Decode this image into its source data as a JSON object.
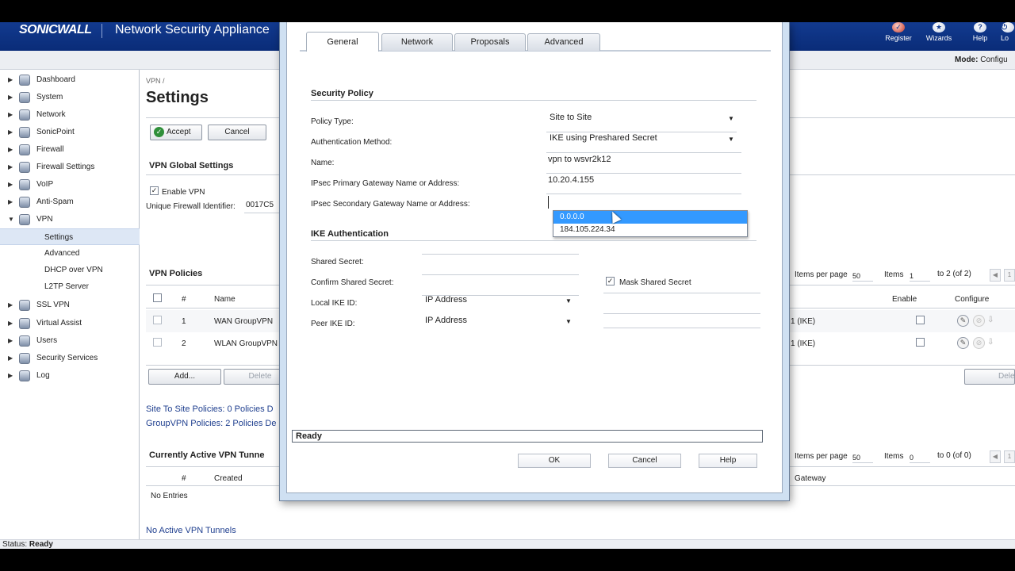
{
  "header": {
    "logo": "SONICWALL",
    "title": "Network Security Appliance",
    "tools": [
      {
        "label": "Register",
        "icon": "register-icon"
      },
      {
        "label": "Wizards",
        "icon": "wizard-icon"
      },
      {
        "label": "Help",
        "icon": "help-icon"
      },
      {
        "label": "Lo",
        "icon": "logout-icon"
      }
    ],
    "mode_label": "Mode:",
    "mode_value": "Configu"
  },
  "sidebar": {
    "items": [
      {
        "label": "Dashboard",
        "icon": "dashboard-icon"
      },
      {
        "label": "System",
        "icon": "system-icon"
      },
      {
        "label": "Network",
        "icon": "network-icon"
      },
      {
        "label": "SonicPoint",
        "icon": "sonicpoint-icon"
      },
      {
        "label": "Firewall",
        "icon": "firewall-icon"
      },
      {
        "label": "Firewall Settings",
        "icon": "firewall-settings-icon"
      },
      {
        "label": "VoIP",
        "icon": "voip-icon"
      },
      {
        "label": "Anti-Spam",
        "icon": "anti-spam-icon"
      },
      {
        "label": "VPN",
        "icon": "vpn-icon"
      },
      {
        "label": "SSL VPN",
        "icon": "ssl-vpn-icon"
      },
      {
        "label": "Virtual Assist",
        "icon": "virtual-assist-icon"
      },
      {
        "label": "Users",
        "icon": "users-icon"
      },
      {
        "label": "Security Services",
        "icon": "security-services-icon"
      },
      {
        "label": "Log",
        "icon": "log-icon"
      }
    ],
    "vpn_sub": [
      "Settings",
      "Advanced",
      "DHCP over VPN",
      "L2TP Server"
    ]
  },
  "main": {
    "breadcrumb": "VPN /",
    "title": "Settings",
    "accept": "Accept",
    "cancel": "Cancel",
    "global_title": "VPN Global Settings",
    "enable_vpn": "Enable VPN",
    "ufi_label": "Unique Firewall Identifier:",
    "ufi_value": "0017C5",
    "policies_title": "VPN Policies",
    "items_per_page_label": "Items per page",
    "items_per_page": "50",
    "items_label": "Items",
    "items_from": "1",
    "items_range": "to 2 (of 2)",
    "col_num": "#",
    "col_name": "Name",
    "col_enable": "Enable",
    "col_configure": "Configure",
    "rows": [
      {
        "num": "1",
        "name": "WAN GroupVPN",
        "gateway": "1 (IKE)"
      },
      {
        "num": "2",
        "name": "WLAN GroupVPN",
        "gateway": "1 (IKE)"
      }
    ],
    "add": "Add...",
    "delete": "Delete",
    "delete_all": "Delete A",
    "site_policies": "Site To Site Policies: 0 Policies D",
    "group_policies": "GroupVPN Policies: 2 Policies De",
    "tunnels_title": "Currently Active VPN Tunne",
    "tunnels_ipp_label": "Items per page",
    "tunnels_ipp": "50",
    "tunnels_items_label": "Items",
    "tunnels_from": "0",
    "tunnels_range": "to 0 (of 0)",
    "tunnels_col_num": "#",
    "tunnels_col_created": "Created",
    "tunnels_col_gateway": "Gateway",
    "no_entries": "No Entries",
    "no_active": "No Active VPN Tunnels",
    "page_btn": "1"
  },
  "statusbar": {
    "label": "Status:",
    "value": "Ready"
  },
  "dialog": {
    "tabs": [
      "General",
      "Network",
      "Proposals",
      "Advanced"
    ],
    "security_policy": "Security Policy",
    "policy_type_label": "Policy Type:",
    "policy_type_value": "Site to Site",
    "auth_method_label": "Authentication Method:",
    "auth_method_value": "IKE using Preshared Secret",
    "name_label": "Name:",
    "name_value": "vpn to wsvr2k12",
    "primary_gw_label": "IPsec Primary Gateway Name or Address:",
    "primary_gw_value": "10.20.4.155",
    "secondary_gw_label": "IPsec Secondary Gateway Name or Address:",
    "secondary_gw_value": "",
    "dropdown_options": [
      "0.0.0.0",
      "184.105.224.34"
    ],
    "ike_auth": "IKE Authentication",
    "shared_secret_label": "Shared Secret:",
    "confirm_secret_label": "Confirm Shared Secret:",
    "mask_secret": "Mask Shared Secret",
    "local_ike_label": "Local IKE ID:",
    "local_ike_value": "IP Address",
    "peer_ike_label": "Peer IKE ID:",
    "peer_ike_value": "IP Address",
    "status": "Ready",
    "ok": "OK",
    "cancel": "Cancel",
    "help": "Help"
  }
}
